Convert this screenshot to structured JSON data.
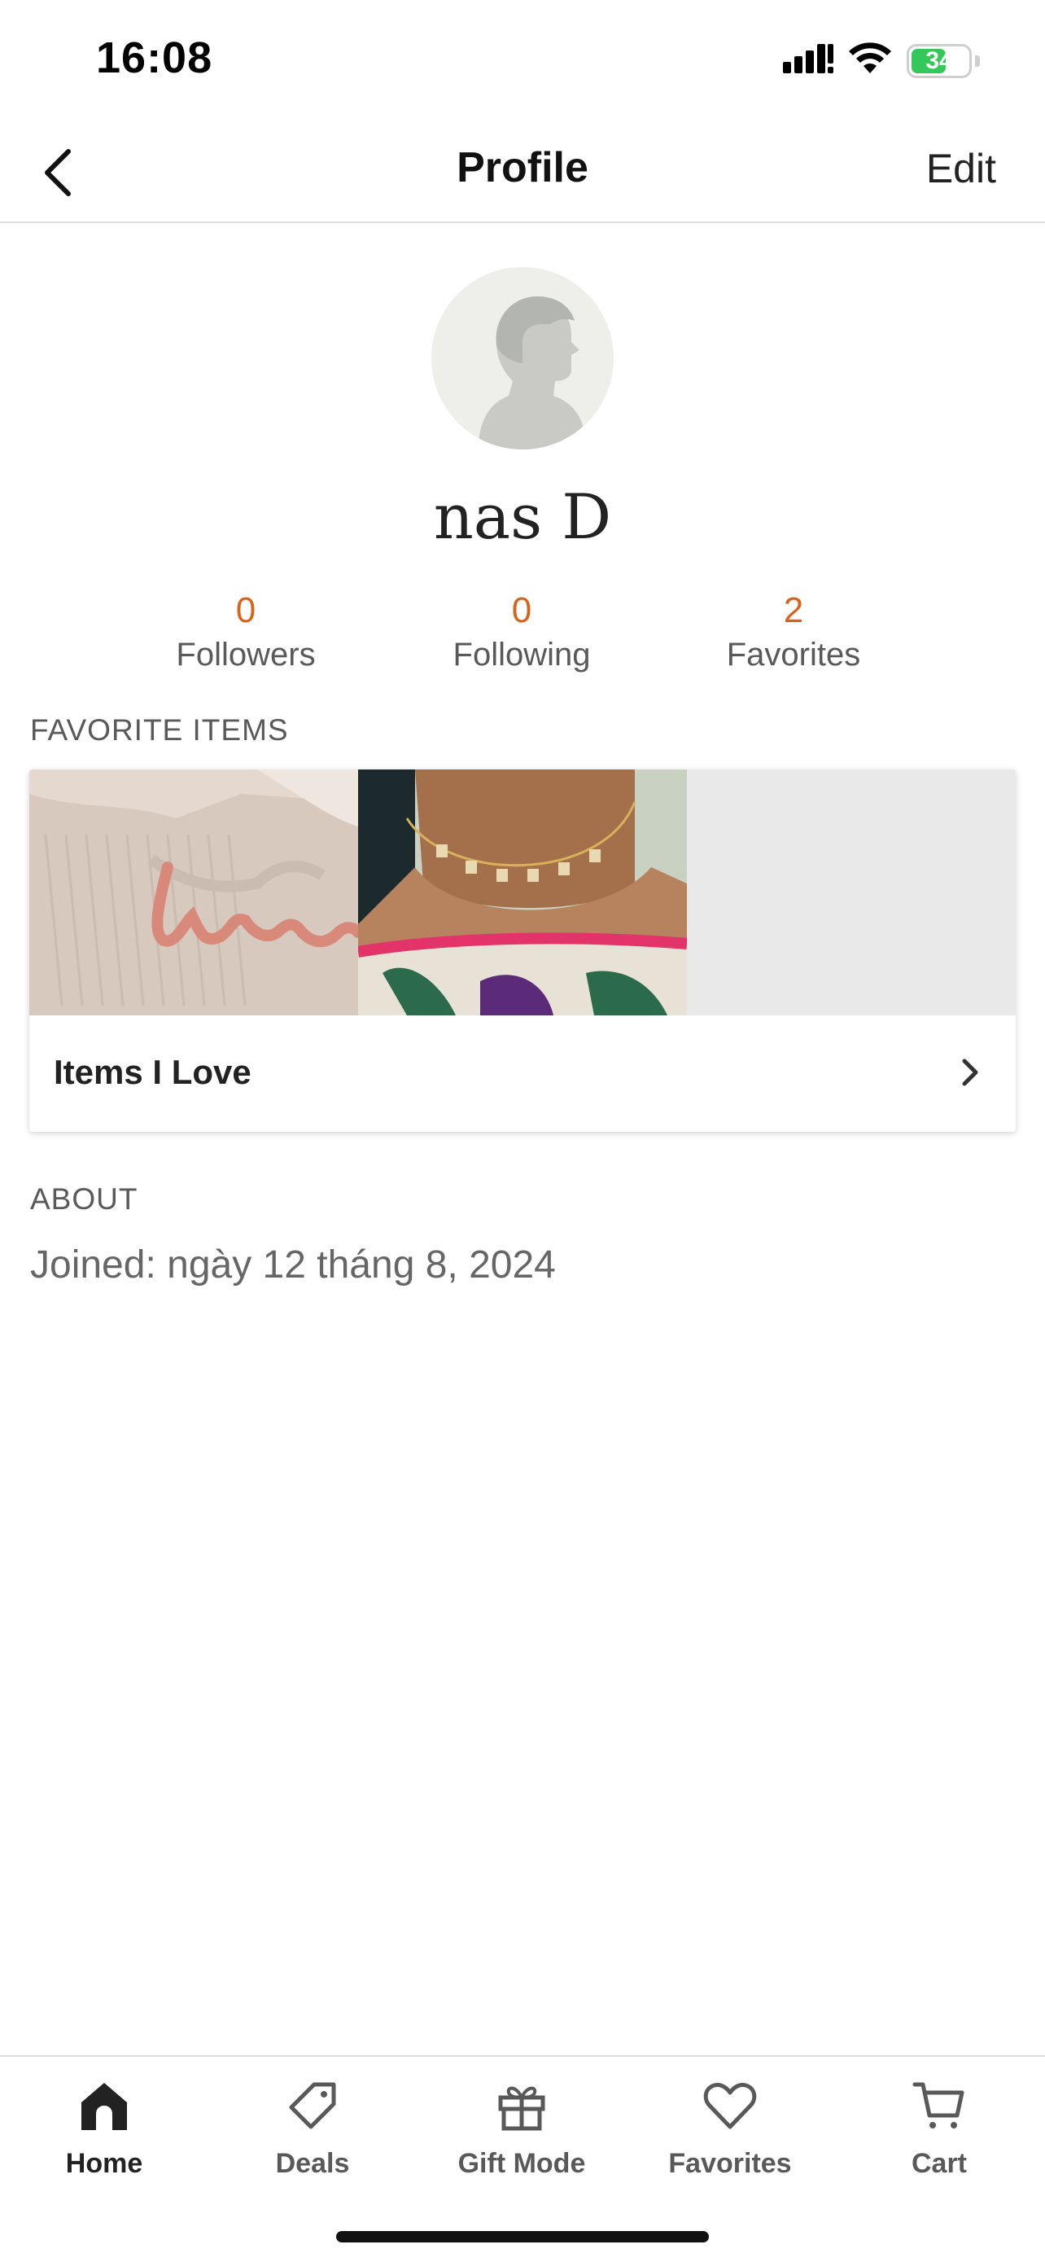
{
  "status_bar": {
    "time": "16:08",
    "battery": "34",
    "icons": [
      "cellular-signal-icon",
      "wifi-icon",
      "battery-charging-icon"
    ]
  },
  "header": {
    "title": "Profile",
    "edit_label": "Edit",
    "back_icon": "chevron-left-icon"
  },
  "profile": {
    "name": "nas D",
    "avatar_icon": "default-avatar-silhouette"
  },
  "stats": [
    {
      "value": "0",
      "label": "Followers"
    },
    {
      "value": "0",
      "label": "Following"
    },
    {
      "value": "2",
      "label": "Favorites"
    }
  ],
  "favorite_items": {
    "section_label": "FAVORITE ITEMS",
    "collection_title": "Items I Love",
    "thumbnails": [
      "knit-sweater-name-embroidery-photo",
      "name-charm-necklace-photo",
      "empty-slot"
    ]
  },
  "about": {
    "section_label": "ABOUT",
    "joined": "Joined: ngày 12 tháng 8, 2024"
  },
  "tab_bar": {
    "tabs": [
      {
        "label": "Home",
        "icon": "home-icon",
        "active": true
      },
      {
        "label": "Deals",
        "icon": "tag-icon",
        "active": false
      },
      {
        "label": "Gift Mode",
        "icon": "gift-icon",
        "active": false
      },
      {
        "label": "Favorites",
        "icon": "heart-icon",
        "active": false
      },
      {
        "label": "Cart",
        "icon": "cart-icon",
        "active": false
      }
    ]
  },
  "colors": {
    "accent": "#d5641c",
    "text_primary": "#222222",
    "text_secondary": "#595959",
    "battery_green": "#34c759"
  }
}
